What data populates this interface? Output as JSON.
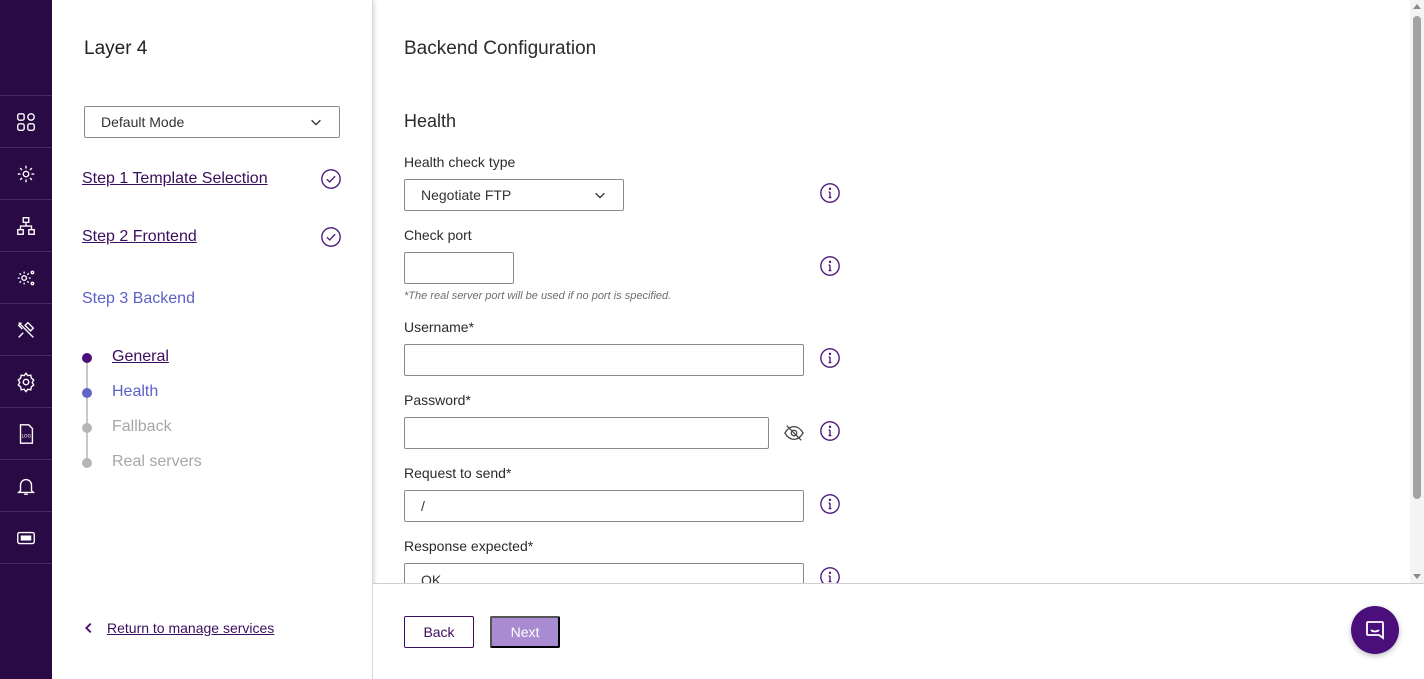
{
  "rail": {
    "icons": [
      "dashboard-icon",
      "cluster-settings-icon",
      "network-icon",
      "advanced-settings-icon",
      "tools-icon",
      "settings-icon",
      "log-file-icon",
      "notifications-bell-icon",
      "ticket-icon"
    ],
    "log_icon_text": "LOG"
  },
  "wizard": {
    "title": "Layer 4",
    "mode_select": "Default Mode",
    "steps": [
      {
        "label": "Step 1 Template Selection",
        "status": "complete"
      },
      {
        "label": "Step 2 Frontend",
        "status": "complete"
      },
      {
        "label": "Step 3 Backend",
        "status": "current"
      }
    ],
    "substeps": [
      {
        "label": "General",
        "status": "done"
      },
      {
        "label": "Health",
        "status": "active"
      },
      {
        "label": "Fallback",
        "status": "todo"
      },
      {
        "label": "Real servers",
        "status": "todo"
      }
    ],
    "return_link": "Return to manage services"
  },
  "main": {
    "title": "Backend Configuration",
    "section": "Health",
    "fields": {
      "health_check_type": {
        "label": "Health check type",
        "value": "Negotiate FTP"
      },
      "check_port": {
        "label": "Check port",
        "value": "",
        "hint": "*The real server port will be used if no port is specified."
      },
      "username": {
        "label": "Username*",
        "value": ""
      },
      "password": {
        "label": "Password*",
        "value": ""
      },
      "request": {
        "label": "Request to send*",
        "value": "/"
      },
      "response": {
        "label": "Response expected*",
        "value": "OK"
      }
    }
  },
  "footer": {
    "back_label": "Back",
    "next_label": "Next"
  },
  "colors": {
    "rail_bg": "#2a0a45",
    "primary": "#4a0f7a",
    "active_step": "#5b5fc7",
    "next_disabled": "#a98bd1"
  }
}
